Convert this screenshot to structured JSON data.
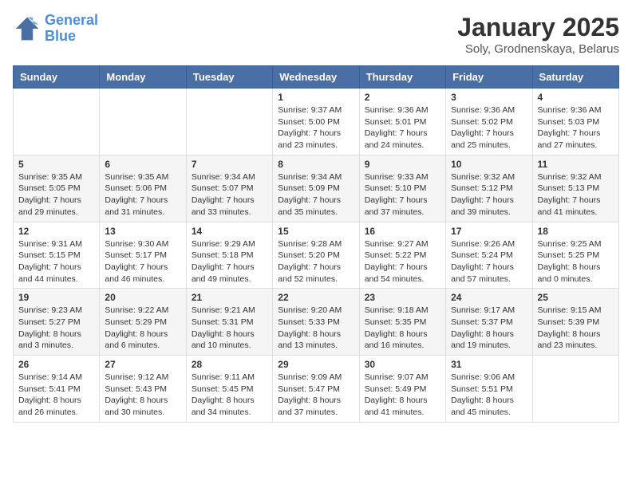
{
  "logo": {
    "line1": "General",
    "line2": "Blue"
  },
  "title": "January 2025",
  "location": "Soly, Grodnenskaya, Belarus",
  "weekdays": [
    "Sunday",
    "Monday",
    "Tuesday",
    "Wednesday",
    "Thursday",
    "Friday",
    "Saturday"
  ],
  "weeks": [
    [
      {
        "day": "",
        "info": ""
      },
      {
        "day": "",
        "info": ""
      },
      {
        "day": "",
        "info": ""
      },
      {
        "day": "1",
        "info": "Sunrise: 9:37 AM\nSunset: 5:00 PM\nDaylight: 7 hours\nand 23 minutes."
      },
      {
        "day": "2",
        "info": "Sunrise: 9:36 AM\nSunset: 5:01 PM\nDaylight: 7 hours\nand 24 minutes."
      },
      {
        "day": "3",
        "info": "Sunrise: 9:36 AM\nSunset: 5:02 PM\nDaylight: 7 hours\nand 25 minutes."
      },
      {
        "day": "4",
        "info": "Sunrise: 9:36 AM\nSunset: 5:03 PM\nDaylight: 7 hours\nand 27 minutes."
      }
    ],
    [
      {
        "day": "5",
        "info": "Sunrise: 9:35 AM\nSunset: 5:05 PM\nDaylight: 7 hours\nand 29 minutes."
      },
      {
        "day": "6",
        "info": "Sunrise: 9:35 AM\nSunset: 5:06 PM\nDaylight: 7 hours\nand 31 minutes."
      },
      {
        "day": "7",
        "info": "Sunrise: 9:34 AM\nSunset: 5:07 PM\nDaylight: 7 hours\nand 33 minutes."
      },
      {
        "day": "8",
        "info": "Sunrise: 9:34 AM\nSunset: 5:09 PM\nDaylight: 7 hours\nand 35 minutes."
      },
      {
        "day": "9",
        "info": "Sunrise: 9:33 AM\nSunset: 5:10 PM\nDaylight: 7 hours\nand 37 minutes."
      },
      {
        "day": "10",
        "info": "Sunrise: 9:32 AM\nSunset: 5:12 PM\nDaylight: 7 hours\nand 39 minutes."
      },
      {
        "day": "11",
        "info": "Sunrise: 9:32 AM\nSunset: 5:13 PM\nDaylight: 7 hours\nand 41 minutes."
      }
    ],
    [
      {
        "day": "12",
        "info": "Sunrise: 9:31 AM\nSunset: 5:15 PM\nDaylight: 7 hours\nand 44 minutes."
      },
      {
        "day": "13",
        "info": "Sunrise: 9:30 AM\nSunset: 5:17 PM\nDaylight: 7 hours\nand 46 minutes."
      },
      {
        "day": "14",
        "info": "Sunrise: 9:29 AM\nSunset: 5:18 PM\nDaylight: 7 hours\nand 49 minutes."
      },
      {
        "day": "15",
        "info": "Sunrise: 9:28 AM\nSunset: 5:20 PM\nDaylight: 7 hours\nand 52 minutes."
      },
      {
        "day": "16",
        "info": "Sunrise: 9:27 AM\nSunset: 5:22 PM\nDaylight: 7 hours\nand 54 minutes."
      },
      {
        "day": "17",
        "info": "Sunrise: 9:26 AM\nSunset: 5:24 PM\nDaylight: 7 hours\nand 57 minutes."
      },
      {
        "day": "18",
        "info": "Sunrise: 9:25 AM\nSunset: 5:25 PM\nDaylight: 8 hours\nand 0 minutes."
      }
    ],
    [
      {
        "day": "19",
        "info": "Sunrise: 9:23 AM\nSunset: 5:27 PM\nDaylight: 8 hours\nand 3 minutes."
      },
      {
        "day": "20",
        "info": "Sunrise: 9:22 AM\nSunset: 5:29 PM\nDaylight: 8 hours\nand 6 minutes."
      },
      {
        "day": "21",
        "info": "Sunrise: 9:21 AM\nSunset: 5:31 PM\nDaylight: 8 hours\nand 10 minutes."
      },
      {
        "day": "22",
        "info": "Sunrise: 9:20 AM\nSunset: 5:33 PM\nDaylight: 8 hours\nand 13 minutes."
      },
      {
        "day": "23",
        "info": "Sunrise: 9:18 AM\nSunset: 5:35 PM\nDaylight: 8 hours\nand 16 minutes."
      },
      {
        "day": "24",
        "info": "Sunrise: 9:17 AM\nSunset: 5:37 PM\nDaylight: 8 hours\nand 19 minutes."
      },
      {
        "day": "25",
        "info": "Sunrise: 9:15 AM\nSunset: 5:39 PM\nDaylight: 8 hours\nand 23 minutes."
      }
    ],
    [
      {
        "day": "26",
        "info": "Sunrise: 9:14 AM\nSunset: 5:41 PM\nDaylight: 8 hours\nand 26 minutes."
      },
      {
        "day": "27",
        "info": "Sunrise: 9:12 AM\nSunset: 5:43 PM\nDaylight: 8 hours\nand 30 minutes."
      },
      {
        "day": "28",
        "info": "Sunrise: 9:11 AM\nSunset: 5:45 PM\nDaylight: 8 hours\nand 34 minutes."
      },
      {
        "day": "29",
        "info": "Sunrise: 9:09 AM\nSunset: 5:47 PM\nDaylight: 8 hours\nand 37 minutes."
      },
      {
        "day": "30",
        "info": "Sunrise: 9:07 AM\nSunset: 5:49 PM\nDaylight: 8 hours\nand 41 minutes."
      },
      {
        "day": "31",
        "info": "Sunrise: 9:06 AM\nSunset: 5:51 PM\nDaylight: 8 hours\nand 45 minutes."
      },
      {
        "day": "",
        "info": ""
      }
    ]
  ]
}
